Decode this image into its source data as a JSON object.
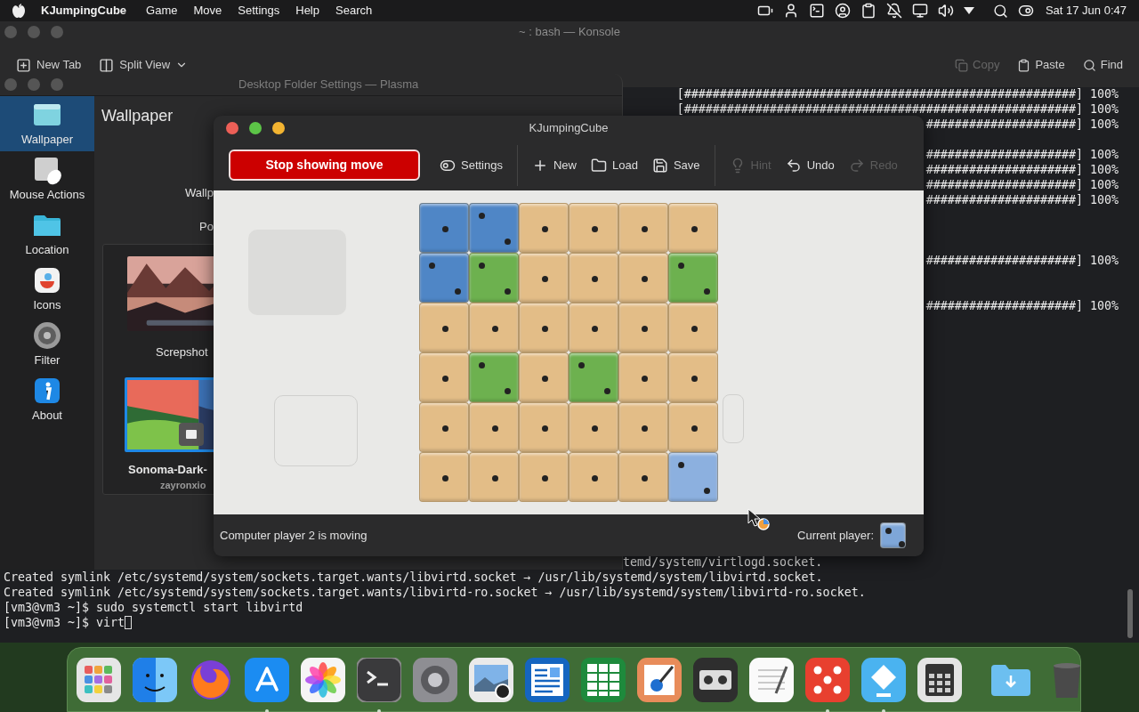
{
  "menu_bar": {
    "app_name": "KJumpingCube",
    "menus": [
      "Game",
      "Move",
      "Settings",
      "Help",
      "Search"
    ],
    "clock": "Sat 17 Jun 0:47"
  },
  "konsole": {
    "title": "~ : bash — Konsole",
    "toolbar_left": [
      {
        "label": "New Tab",
        "kind": "button",
        "disabled": false
      },
      {
        "label": "Split View",
        "kind": "dropdown",
        "disabled": false
      }
    ],
    "toolbar_right": [
      {
        "label": "Copy",
        "disabled": true
      },
      {
        "label": "Paste",
        "disabled": false
      },
      {
        "label": "Find",
        "disabled": false
      }
    ],
    "progress_lines": [
      {
        "text": "[#######################################################] 100%"
      },
      {
        "text": "[#######################################################] 100%"
      },
      {
        "text": "#####################] 100%"
      },
      {
        "text": "#####################] 100%"
      },
      {
        "text": "#####################] 100%"
      },
      {
        "text": "#####################] 100%"
      },
      {
        "text": "#####################] 100%"
      },
      {
        "text": "#####################] 100%"
      },
      {
        "text": "#####################] 100%"
      }
    ],
    "lines": [
      {
        "kind": "continuation",
        "text": "temd/system/virtlogd.socket."
      },
      {
        "kind": "output",
        "text": "Created symlink /etc/systemd/system/sockets.target.wants/libvirtd.socket → /usr/lib/systemd/system/libvirtd.socket."
      },
      {
        "kind": "output",
        "text": "Created symlink /etc/systemd/system/sockets.target.wants/libvirtd-ro.socket → /usr/lib/systemd/system/libvirtd-ro.socket."
      },
      {
        "kind": "output",
        "text": "[vm3@vm3 ~]$ sudo systemctl start libvirtd"
      },
      {
        "kind": "prompt",
        "text": "[vm3@vm3 ~]$ virt"
      }
    ]
  },
  "settings": {
    "title": "Desktop Folder Settings — Plasma",
    "sidebar": [
      {
        "label": "Wallpaper",
        "selected": true
      },
      {
        "label": "Mouse Actions",
        "selected": false
      },
      {
        "label": "Location",
        "selected": false
      },
      {
        "label": "Icons",
        "selected": false
      },
      {
        "label": "Filter",
        "selected": false
      },
      {
        "label": "About",
        "selected": false
      }
    ],
    "heading": "Wallpaper",
    "field_labels": [
      "Wallp",
      "Po"
    ],
    "wallpapers": [
      {
        "name": "Screpshot",
        "selected": false
      },
      {
        "name": "Sonoma-Dark-",
        "author": "zayronxio",
        "selected": true
      }
    ]
  },
  "game": {
    "title": "KJumpingCube",
    "toolbar": [
      {
        "kind": "primary",
        "label": "Stop showing move",
        "disabled": false
      },
      {
        "kind": "tool",
        "label": "Settings",
        "disabled": false
      },
      {
        "kind": "separator"
      },
      {
        "kind": "tool",
        "label": "New",
        "disabled": false
      },
      {
        "kind": "tool",
        "label": "Load",
        "disabled": false
      },
      {
        "kind": "tool",
        "label": "Save",
        "disabled": false
      },
      {
        "kind": "separator"
      },
      {
        "kind": "tool",
        "label": "Hint",
        "disabled": true
      },
      {
        "kind": "tool",
        "label": "Undo",
        "disabled": false
      },
      {
        "kind": "tool",
        "label": "Redo",
        "disabled": true
      }
    ],
    "board": [
      [
        {
          "color": "#4f86c6",
          "kind": "one"
        },
        {
          "color": "#4f86c6",
          "kind": "two"
        },
        {
          "color": "#e3bd87",
          "kind": "one"
        },
        {
          "color": "#e3bd87",
          "kind": "one"
        },
        {
          "color": "#e3bd87",
          "kind": "one"
        },
        {
          "color": "#e3bd87",
          "kind": "one"
        }
      ],
      [
        {
          "color": "#4f86c6",
          "kind": "two"
        },
        {
          "color": "#6db14f",
          "kind": "two"
        },
        {
          "color": "#e3bd87",
          "kind": "one"
        },
        {
          "color": "#e3bd87",
          "kind": "one"
        },
        {
          "color": "#e3bd87",
          "kind": "one"
        },
        {
          "color": "#6db14f",
          "kind": "two"
        }
      ],
      [
        {
          "color": "#e3bd87",
          "kind": "one"
        },
        {
          "color": "#e3bd87",
          "kind": "one"
        },
        {
          "color": "#e3bd87",
          "kind": "one"
        },
        {
          "color": "#e3bd87",
          "kind": "one"
        },
        {
          "color": "#e3bd87",
          "kind": "one"
        },
        {
          "color": "#e3bd87",
          "kind": "one"
        }
      ],
      [
        {
          "color": "#e3bd87",
          "kind": "one"
        },
        {
          "color": "#6db14f",
          "kind": "two"
        },
        {
          "color": "#e3bd87",
          "kind": "one"
        },
        {
          "color": "#6db14f",
          "kind": "two"
        },
        {
          "color": "#e3bd87",
          "kind": "one"
        },
        {
          "color": "#e3bd87",
          "kind": "one"
        }
      ],
      [
        {
          "color": "#e3bd87",
          "kind": "one"
        },
        {
          "color": "#e3bd87",
          "kind": "one"
        },
        {
          "color": "#e3bd87",
          "kind": "one"
        },
        {
          "color": "#e3bd87",
          "kind": "one"
        },
        {
          "color": "#e3bd87",
          "kind": "one"
        },
        {
          "color": "#e3bd87",
          "kind": "one"
        }
      ],
      [
        {
          "color": "#e3bd87",
          "kind": "one"
        },
        {
          "color": "#e3bd87",
          "kind": "one"
        },
        {
          "color": "#e3bd87",
          "kind": "one"
        },
        {
          "color": "#e3bd87",
          "kind": "one"
        },
        {
          "color": "#e3bd87",
          "kind": "one"
        },
        {
          "color": "#8cb0df",
          "kind": "two"
        }
      ]
    ],
    "status": "Computer player 2 is moving",
    "current_player_label": "Current player:",
    "current_player": {
      "color": "#7ea6d8",
      "kind": "two"
    }
  },
  "dock": [
    {
      "running": false
    },
    {
      "running": false
    },
    {
      "running": false
    },
    {
      "running": true
    },
    {
      "running": false
    },
    {
      "running": true
    },
    {
      "running": false
    },
    {
      "running": false
    },
    {
      "running": false
    },
    {
      "running": false
    },
    {
      "running": false
    },
    {
      "running": false
    },
    {
      "running": false
    },
    {
      "running": true
    },
    {
      "running": true
    },
    {
      "running": false
    },
    {
      "running": false
    },
    {
      "running": false
    }
  ]
}
